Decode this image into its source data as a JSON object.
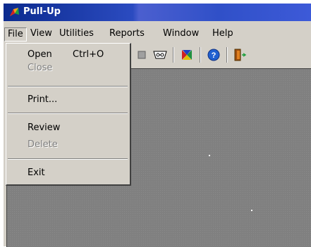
{
  "window": {
    "title": "Pull-Up"
  },
  "menubar": {
    "items": [
      "File",
      "View",
      "Utilities",
      "Reports",
      "Window",
      "Help"
    ]
  },
  "file_menu": {
    "items": [
      {
        "label": "Open",
        "shortcut": "Ctrl+O",
        "enabled": true
      },
      {
        "label": "Close",
        "enabled": false
      },
      {
        "label": "Print...",
        "enabled": true
      },
      {
        "label": "Review",
        "enabled": true
      },
      {
        "label": "Delete",
        "enabled": false
      },
      {
        "label": "Exit",
        "enabled": true
      }
    ]
  },
  "toolbar": {
    "buttons": [
      "stop-icon",
      "tape-cassette-icon",
      "hourglass-icon",
      "help-icon",
      "exit-door-icon"
    ]
  },
  "colors": {
    "title_bar": "#0b2a8e",
    "face": "#d4d0c8",
    "client_area": "#808080"
  }
}
